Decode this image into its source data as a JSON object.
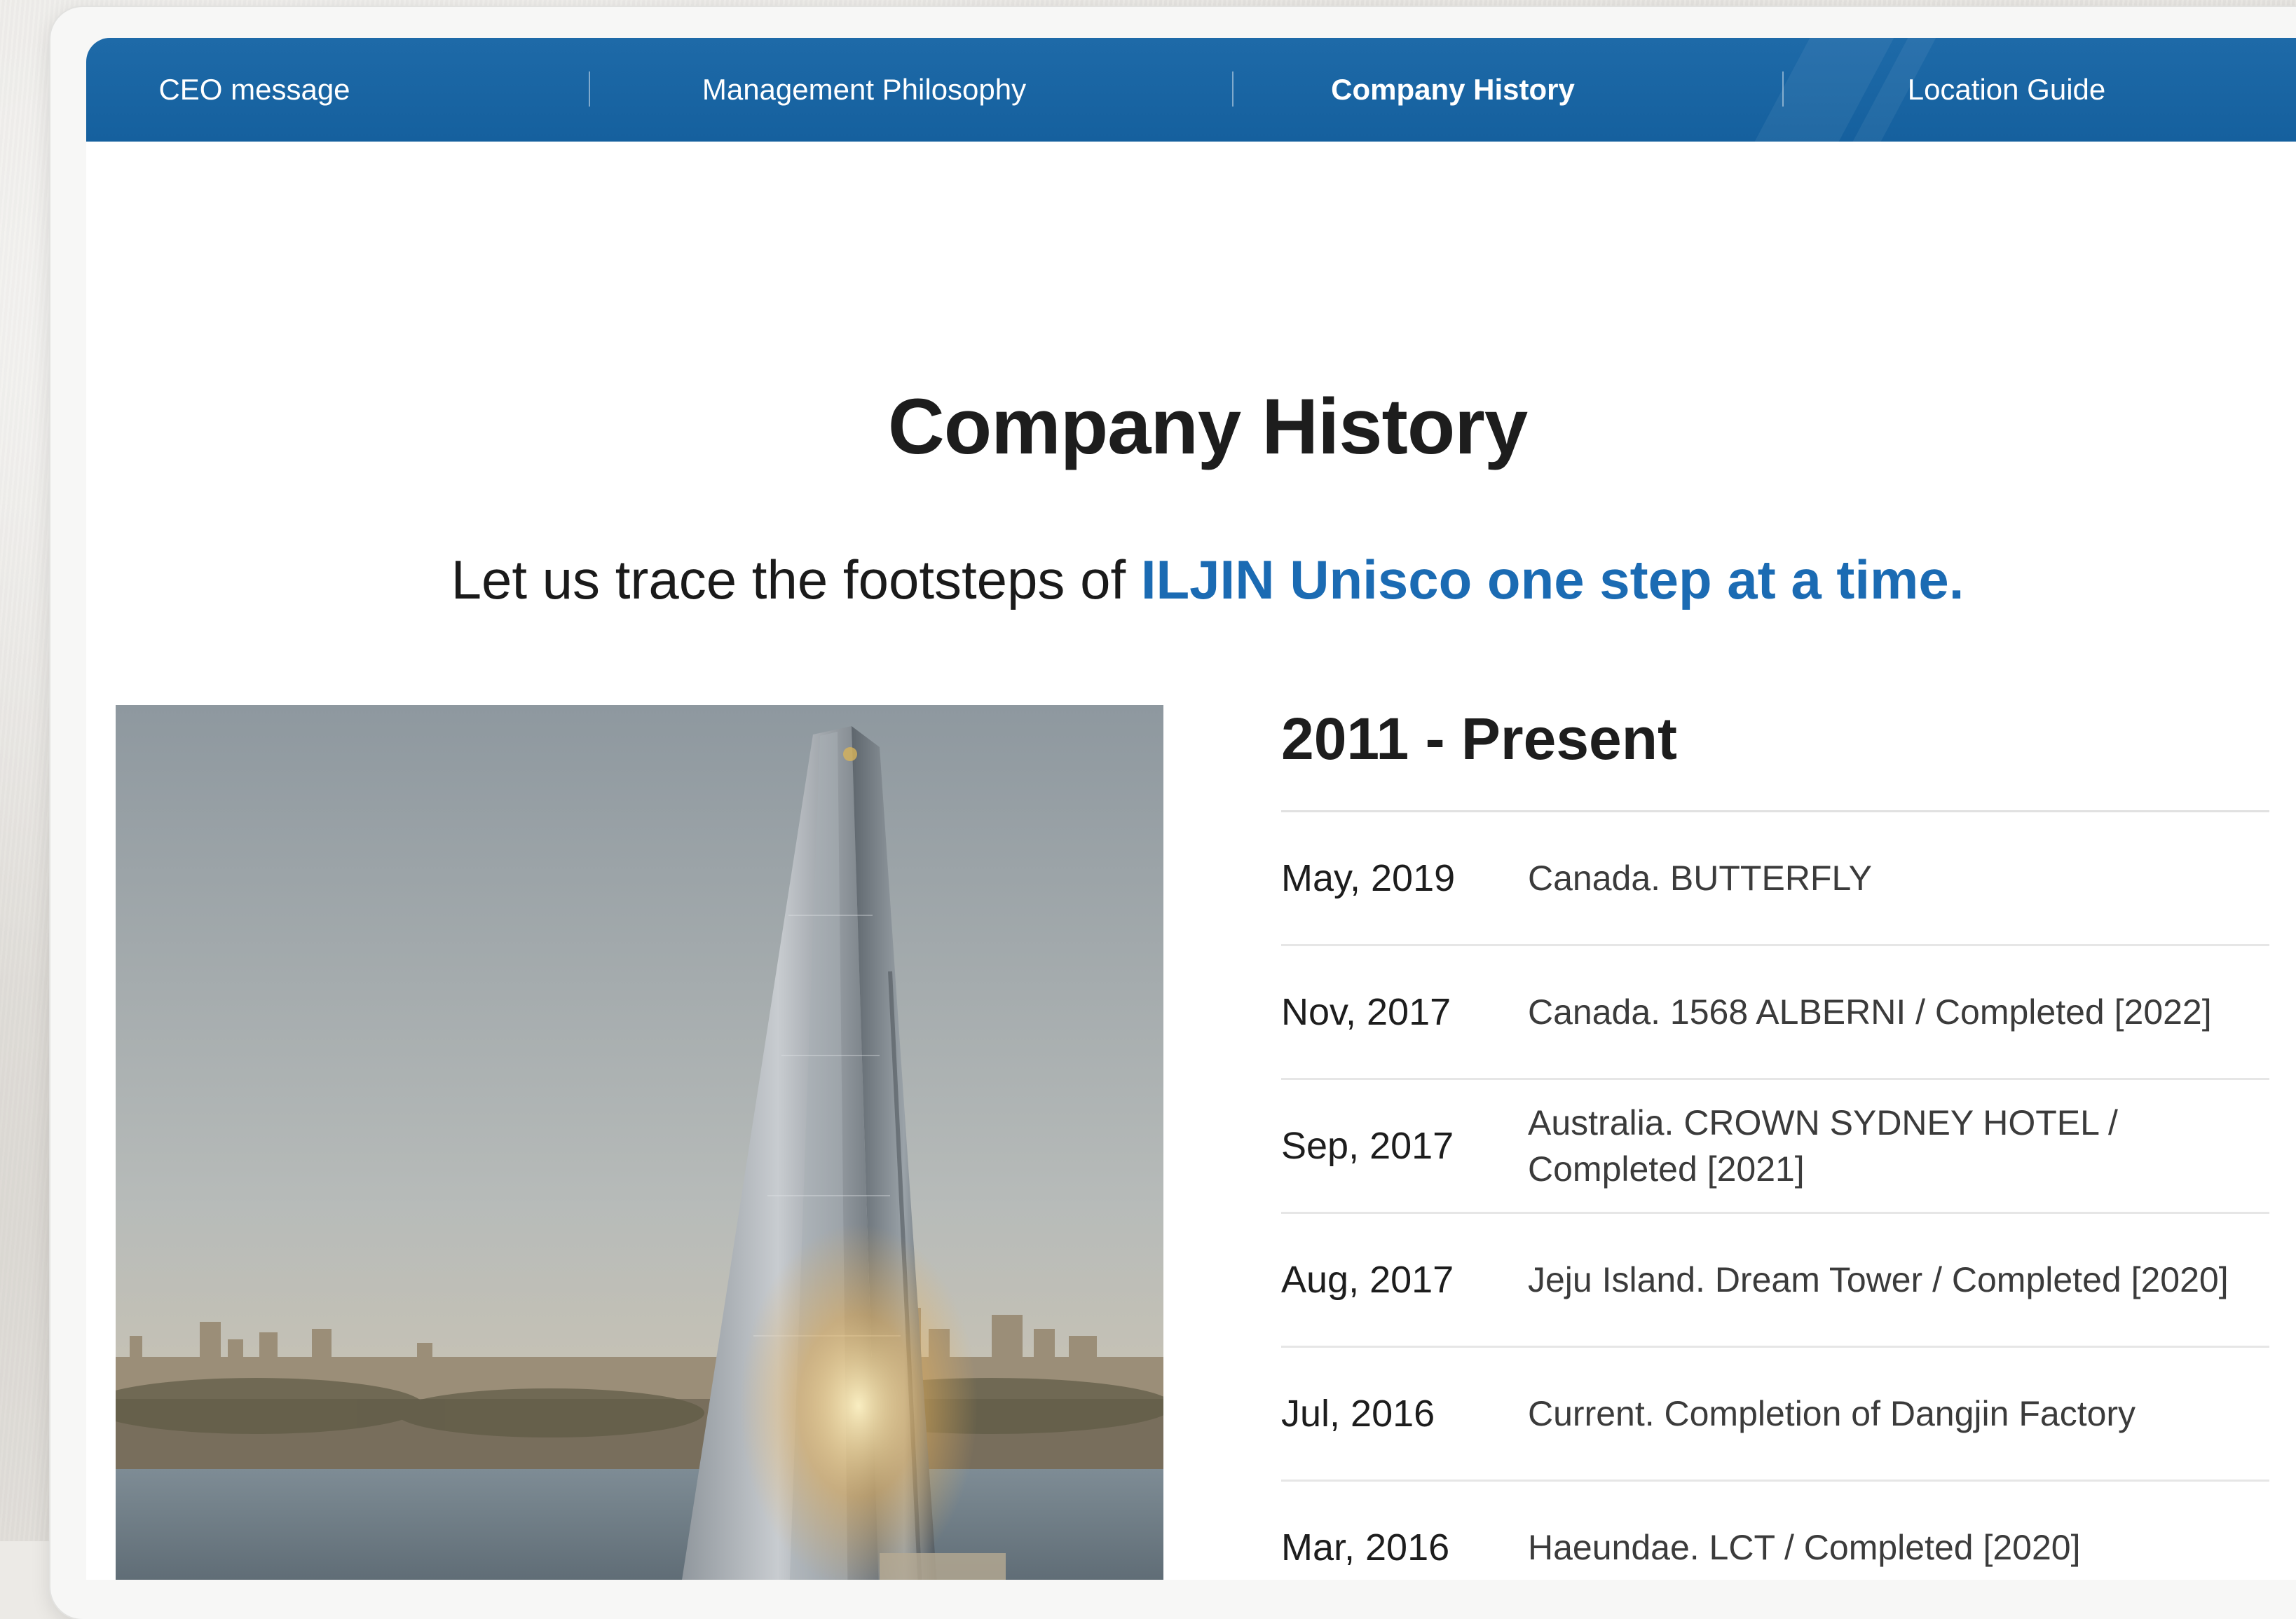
{
  "nav": {
    "items": [
      {
        "label": "CEO message",
        "active": false
      },
      {
        "label": "Management Philosophy",
        "active": false
      },
      {
        "label": "Company History",
        "active": true
      },
      {
        "label": "Location Guide",
        "active": false
      }
    ]
  },
  "header": {
    "title": "Company History",
    "subtitle_prefix": "Let us trace the footsteps of ",
    "subtitle_accent": "ILJIN Unisco one step at a time."
  },
  "timeline": {
    "period": "2011 - Present",
    "entries": [
      {
        "date": "May, 2019",
        "event": "Canada. BUTTERFLY"
      },
      {
        "date": "Nov, 2017",
        "event": "Canada. 1568 ALBERNI / Completed [2022]"
      },
      {
        "date": "Sep, 2017",
        "event": "Australia. CROWN SYDNEY HOTEL / Completed [2021]"
      },
      {
        "date": "Aug, 2017",
        "event": "Jeju Island. Dream Tower / Completed [2020]"
      },
      {
        "date": "Jul, 2016",
        "event": "Current. Completion of Dangjin Factory"
      },
      {
        "date": "Mar, 2016",
        "event": "Haeundae. LCT / Completed [2020]"
      }
    ]
  },
  "colors": {
    "nav_background": "#1e6aa8",
    "accent": "#1b6bb3",
    "title_text": "#1d1d1d"
  }
}
